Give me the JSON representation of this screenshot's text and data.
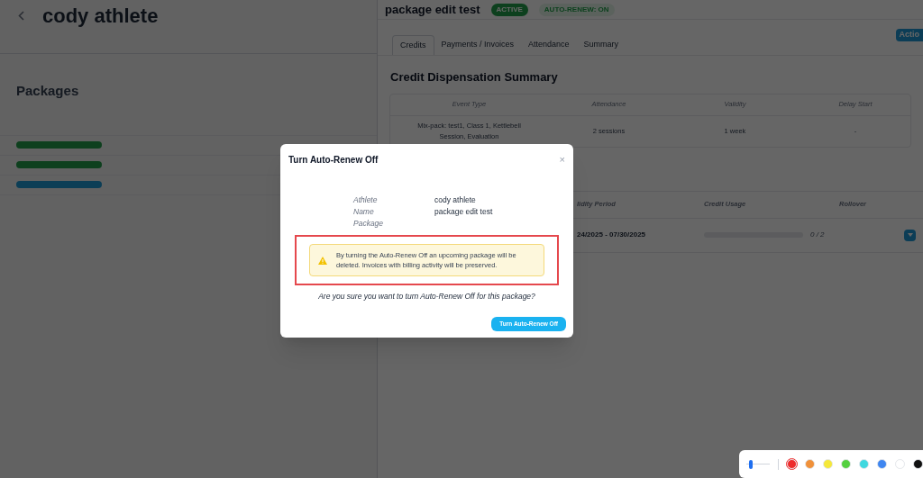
{
  "profile": {
    "title": "cody athlete",
    "packages": {
      "title": "Packages",
      "rows": [
        {
          "color": "#0e401e"
        },
        {
          "color": "#0e401e"
        },
        {
          "color": "#0c3e56"
        }
      ]
    }
  },
  "drawer": {
    "title": "package edit test",
    "badges": [
      {
        "label": "ACTIVE",
        "kind": "solid"
      },
      {
        "label": "AUTO-RENEW: ON",
        "kind": "soft"
      }
    ],
    "tabs": [
      {
        "label": "Credits",
        "selected": true
      },
      {
        "label": "Payments / Invoices",
        "selected": false
      },
      {
        "label": "Attendance",
        "selected": false
      },
      {
        "label": "Summary",
        "selected": false
      }
    ],
    "action_button": "Actio",
    "summary": {
      "title": "Credit Dispensation Summary",
      "columns": [
        "Event Type",
        "Attendance",
        "Validity",
        "Delay Start"
      ],
      "rows": [
        [
          "Mix-pack: test1, Class 1, Kettlebell Session, Evaluation",
          "2 sessions",
          "1 week",
          "-"
        ]
      ]
    },
    "periods": {
      "columns": [
        "lidity Period",
        "Credit Usage",
        "Rollover"
      ],
      "rows": [
        {
          "period": "24/2025 - 07/30/2025",
          "level": 0,
          "usage": "0 / 2"
        }
      ]
    }
  },
  "dialog": {
    "title": "Turn Auto-Renew Off",
    "close": "×",
    "labels": [
      "Athlete",
      "Name",
      "Package"
    ],
    "values": [
      "cody athlete",
      "package edit test"
    ],
    "warning": "By turning the Auto-Renew Off an upcoming package will be deleted. Invoices with billing activity will be preserved.",
    "question": "Are you sure you want to turn Auto-Renew Off for this package?",
    "confirm_button": "Turn Auto-Renew Off"
  },
  "annotation_toolbar": {
    "size_slider": {
      "level": 0.1
    },
    "colors": [
      {
        "color": "#ee2b2b",
        "selected": true
      },
      {
        "color": "#f0913a",
        "selected": false
      },
      {
        "color": "#f5e83a",
        "selected": false
      },
      {
        "color": "#55d040",
        "selected": false
      },
      {
        "color": "#40d8df",
        "selected": false
      },
      {
        "color": "#3f86f0",
        "selected": false
      },
      {
        "color": "#ffffff",
        "selected": false
      },
      {
        "color": "#111111",
        "selected": false
      }
    ]
  }
}
